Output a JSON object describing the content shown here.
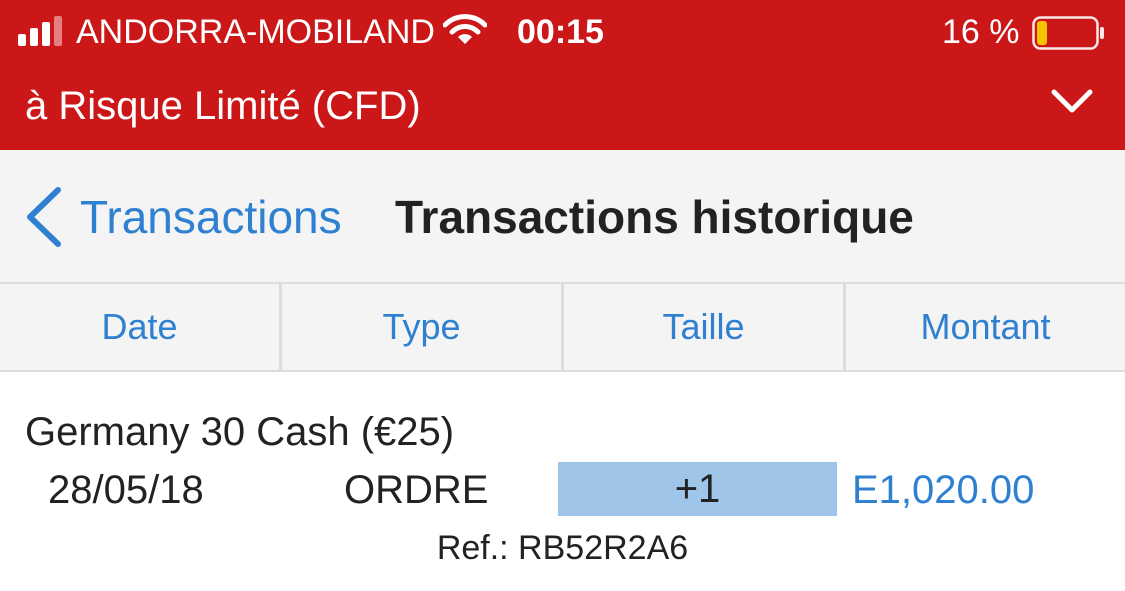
{
  "status_bar": {
    "carrier": "ANDORRA-MOBILAND",
    "time": "00:15",
    "battery_percent": "16 %",
    "battery_level": 0.16,
    "signal_bars_active": 3,
    "signal_bars_total": 4,
    "icons": {
      "wifi": "wifi-icon",
      "battery": "battery-icon",
      "signal": "cellular-signal-icon"
    }
  },
  "account_header": {
    "title": "à Risque Limité (CFD)",
    "toggle_icon": "chevron-down-icon"
  },
  "nav": {
    "back_label": "Transactions",
    "back_icon": "chevron-left-icon",
    "title": "Transactions historique"
  },
  "columns": [
    "Date",
    "Type",
    "Taille",
    "Montant"
  ],
  "transactions": [
    {
      "instrument": "Germany 30 Cash (€25)",
      "date": "28/05/18",
      "type": "ORDRE",
      "size": "+1",
      "amount": "E1,020.00",
      "ref": "Ref.: RB52R2A6"
    }
  ],
  "colors": {
    "header_red": "#cc1719",
    "link_blue": "#2f80d1",
    "size_highlight": "#9fc5e8",
    "battery_low": "#f5c400"
  }
}
